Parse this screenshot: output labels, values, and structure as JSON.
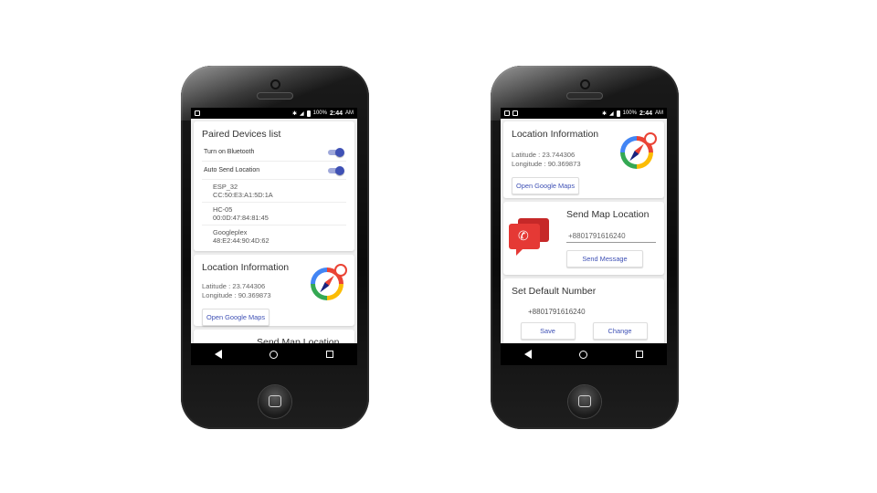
{
  "status_bar": {
    "battery": "100%",
    "time": "2:44",
    "ampm": "AM"
  },
  "phone1": {
    "paired": {
      "title": "Paired Devices list",
      "toggles": [
        {
          "label": "Turn on Bluetooth",
          "on": true
        },
        {
          "label": "Auto Send Location",
          "on": true
        }
      ],
      "devices": [
        {
          "name": "ESP_32",
          "address": "CC:50:E3:A1:5D:1A"
        },
        {
          "name": "HC-05",
          "address": "00:0D:47:84:81:45"
        },
        {
          "name": "Googleplex",
          "address": "48:E2:44:90:4D:62"
        }
      ]
    },
    "location": {
      "title": "Location Information",
      "latitude": "Latitude :  23.744306",
      "longitude": "Longitude : 90.369873",
      "button": "Open Google Maps"
    },
    "send_map": {
      "title": "Send Map Location"
    }
  },
  "phone2": {
    "location": {
      "title": "Location Information",
      "latitude": "Latitude :  23.744306",
      "longitude": "Longitude : 90.369873",
      "button": "Open Google Maps"
    },
    "send_map": {
      "title": "Send Map Location",
      "phone_value": "+8801791616240",
      "button": "Send Message"
    },
    "default_number": {
      "title": "Set Default Number",
      "number": "+8801791616240",
      "save": "Save",
      "change": "Change"
    }
  },
  "colors": {
    "accent": "#3f51b5",
    "toggle_track": "#9fa8da",
    "chat_red": "#e53935"
  }
}
